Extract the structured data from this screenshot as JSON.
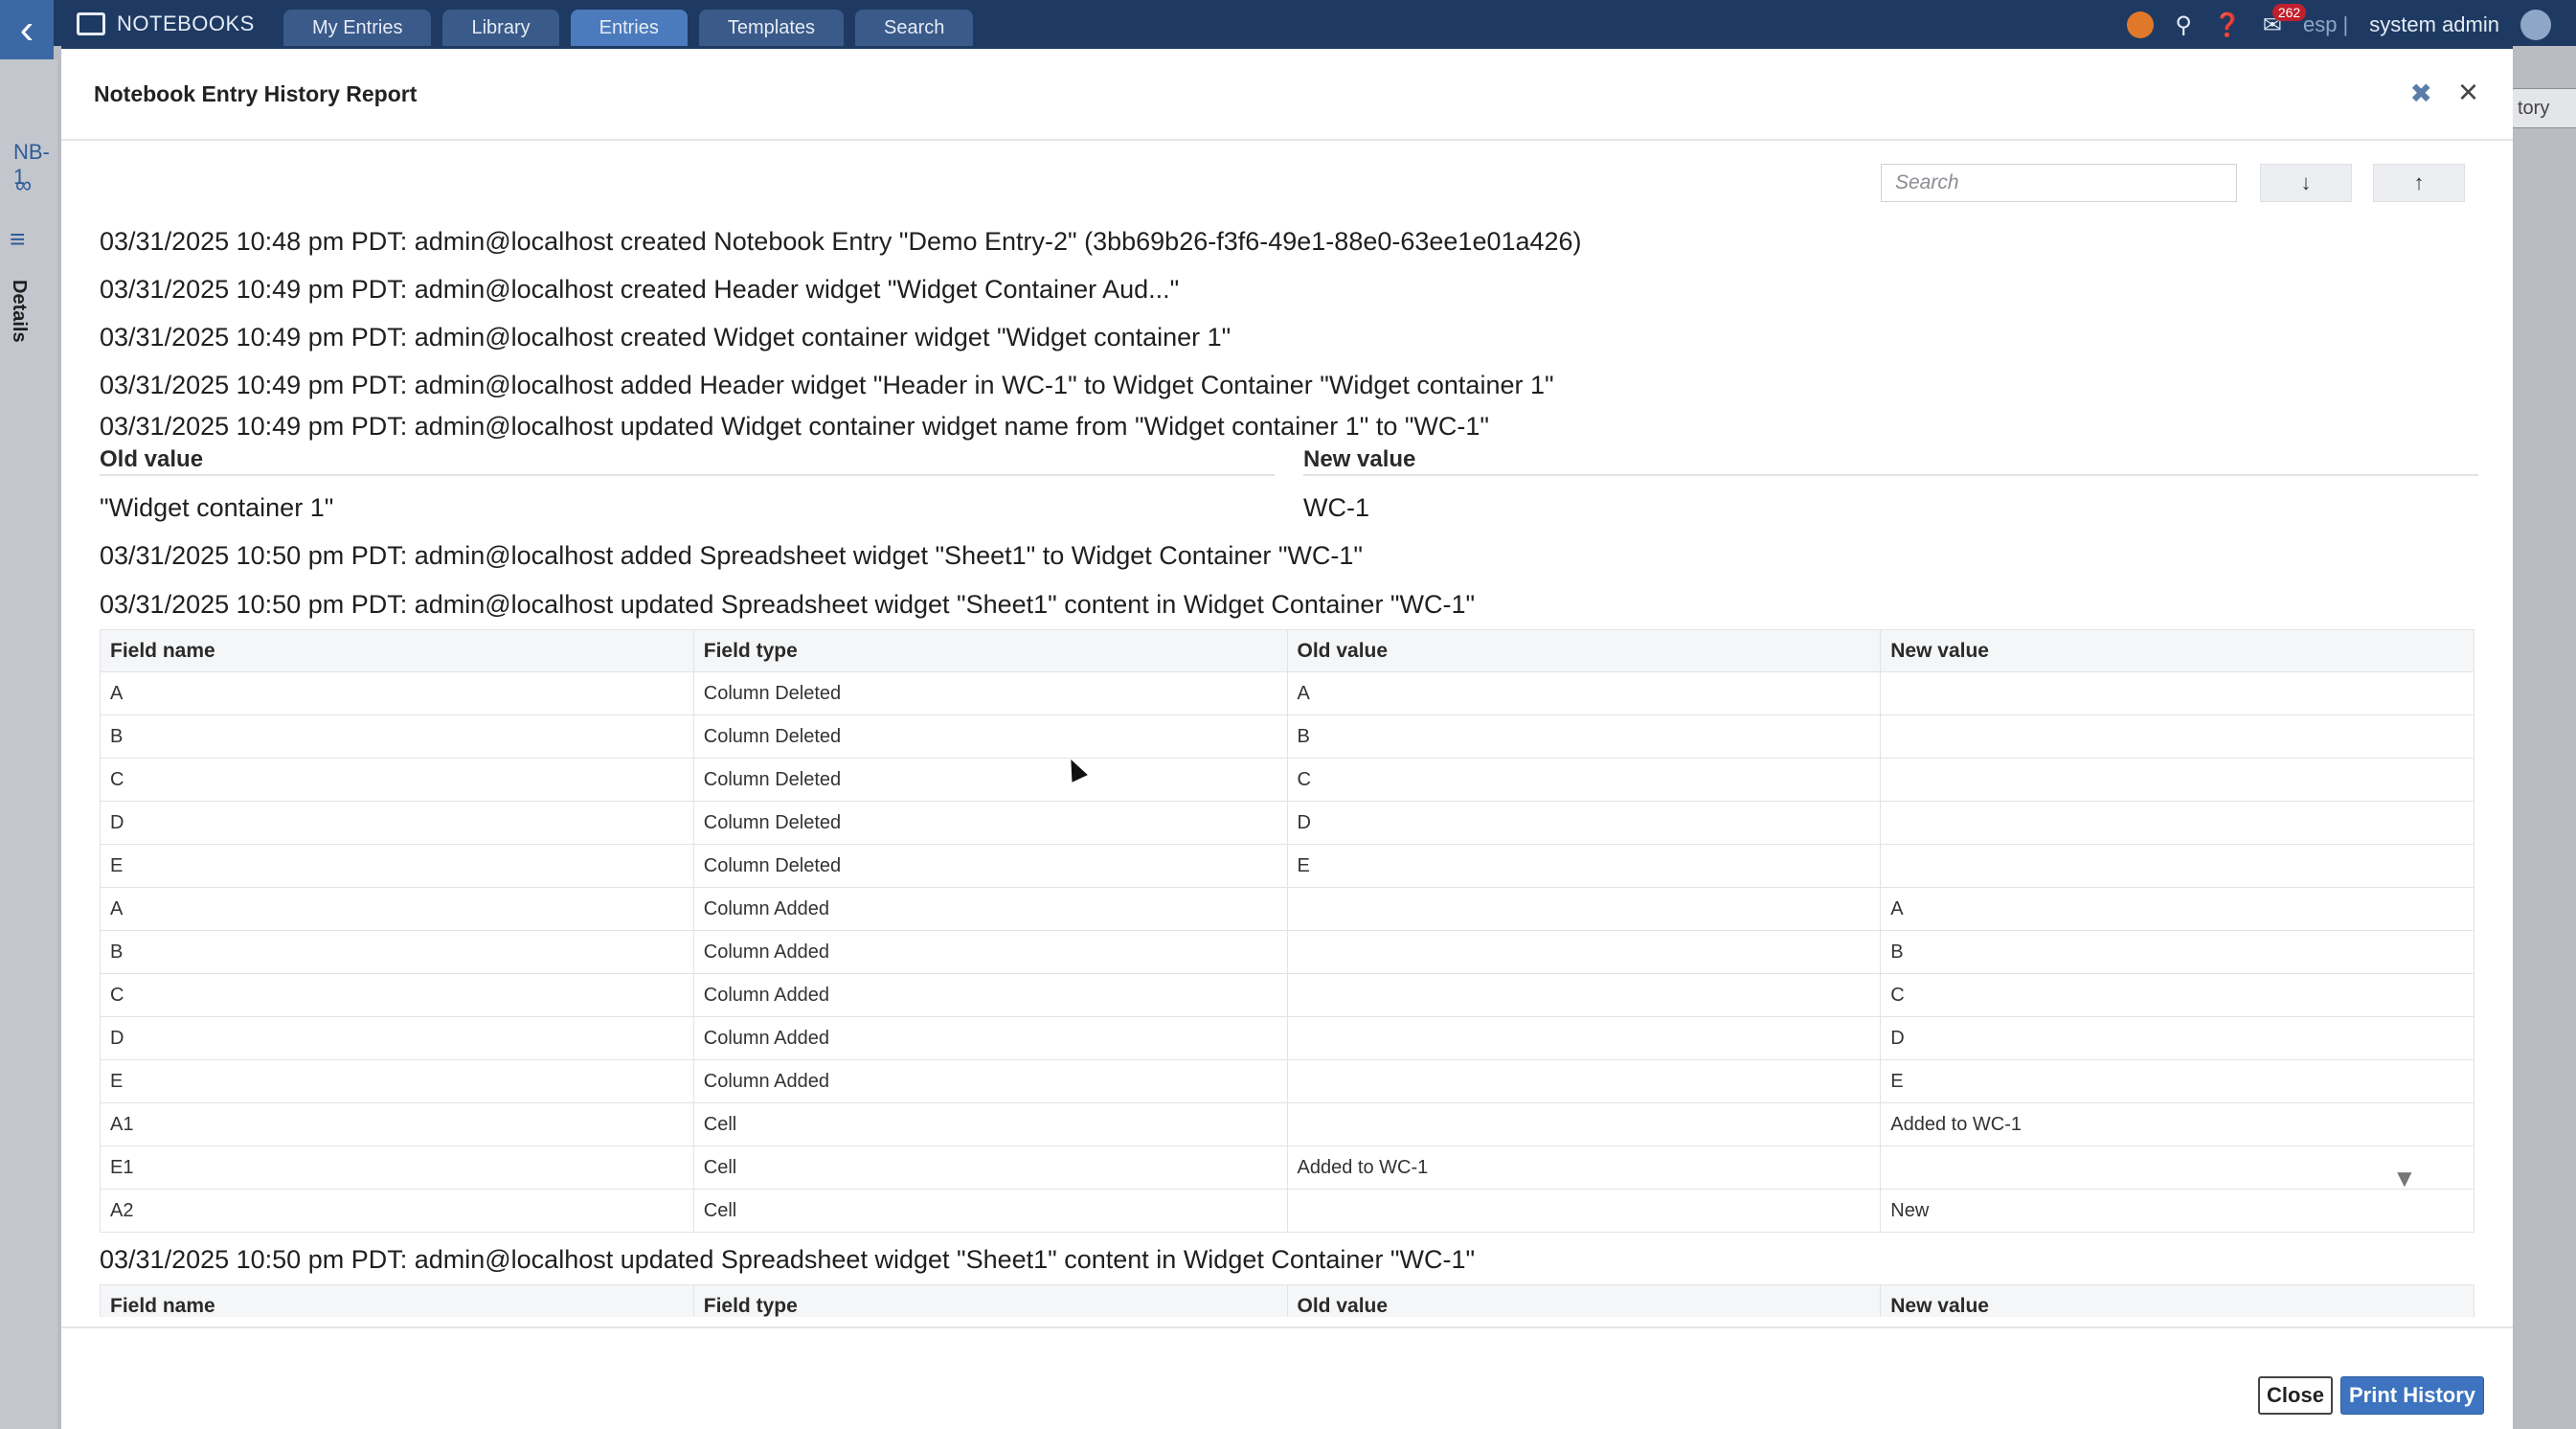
{
  "nav": {
    "brand": "NOTEBOOKS",
    "tabs": [
      {
        "label": "My Entries"
      },
      {
        "label": "Library"
      },
      {
        "label": "Entries"
      },
      {
        "label": "Templates"
      },
      {
        "label": "Search"
      }
    ],
    "active_tab": "Entries",
    "notification_count": "262",
    "language": "esp |",
    "user": "system admin"
  },
  "left_rail": {
    "notebook_id": "NB-1",
    "details_label": "Details",
    "history_tab_label": "tory"
  },
  "modal": {
    "title": "Notebook Entry History Report",
    "search": {
      "placeholder": "Search",
      "value": ""
    },
    "entries": [
      "03/31/2025 10:48 pm PDT: admin@localhost created Notebook Entry \"Demo Entry-2\" (3bb69b26-f3f6-49e1-88e0-63ee1e01a426)",
      "03/31/2025 10:49 pm PDT: admin@localhost created Header widget \"Widget Container Aud...\"",
      "03/31/2025 10:49 pm PDT: admin@localhost created Widget container widget \"Widget container 1\"",
      "03/31/2025 10:49 pm PDT: admin@localhost added Header widget \"Header in WC-1\" to Widget Container \"Widget container 1\"",
      "03/31/2025 10:49 pm PDT: admin@localhost updated Widget container widget name from \"Widget container 1\" to \"WC-1\"",
      "03/31/2025 10:50 pm PDT: admin@localhost added Spreadsheet widget \"Sheet1\" to Widget Container \"WC-1\"",
      "03/31/2025 10:50 pm PDT: admin@localhost updated Spreadsheet widget \"Sheet1\" content in Widget Container \"WC-1\"",
      "03/31/2025 10:50 pm PDT: admin@localhost updated Spreadsheet widget \"Sheet1\" content in Widget Container \"WC-1\""
    ],
    "name_diff": {
      "old_label": "Old value",
      "new_label": "New value",
      "old_value": "\"Widget container 1\"",
      "new_value": "WC-1"
    },
    "table_headers": [
      "Field name",
      "Field type",
      "Old value",
      "New value"
    ],
    "table_rows": [
      [
        "A",
        "Column Deleted",
        "A",
        ""
      ],
      [
        "B",
        "Column Deleted",
        "B",
        ""
      ],
      [
        "C",
        "Column Deleted",
        "C",
        ""
      ],
      [
        "D",
        "Column Deleted",
        "D",
        ""
      ],
      [
        "E",
        "Column Deleted",
        "E",
        ""
      ],
      [
        "A",
        "Column Added",
        "",
        "A"
      ],
      [
        "B",
        "Column Added",
        "",
        "B"
      ],
      [
        "C",
        "Column Added",
        "",
        "C"
      ],
      [
        "D",
        "Column Added",
        "",
        "D"
      ],
      [
        "E",
        "Column Added",
        "",
        "E"
      ],
      [
        "A1",
        "Cell",
        "",
        "Added to WC-1"
      ],
      [
        "E1",
        "Cell",
        "Added to WC-1",
        ""
      ],
      [
        "A2",
        "Cell",
        "",
        "New"
      ]
    ],
    "close_label": "Close",
    "print_label": "Print History"
  },
  "colors": {
    "nav_bg": "#1e3a63",
    "active_tab": "#4c7bbd",
    "primary_button": "#3d73bf",
    "badge": "#c0202c"
  }
}
